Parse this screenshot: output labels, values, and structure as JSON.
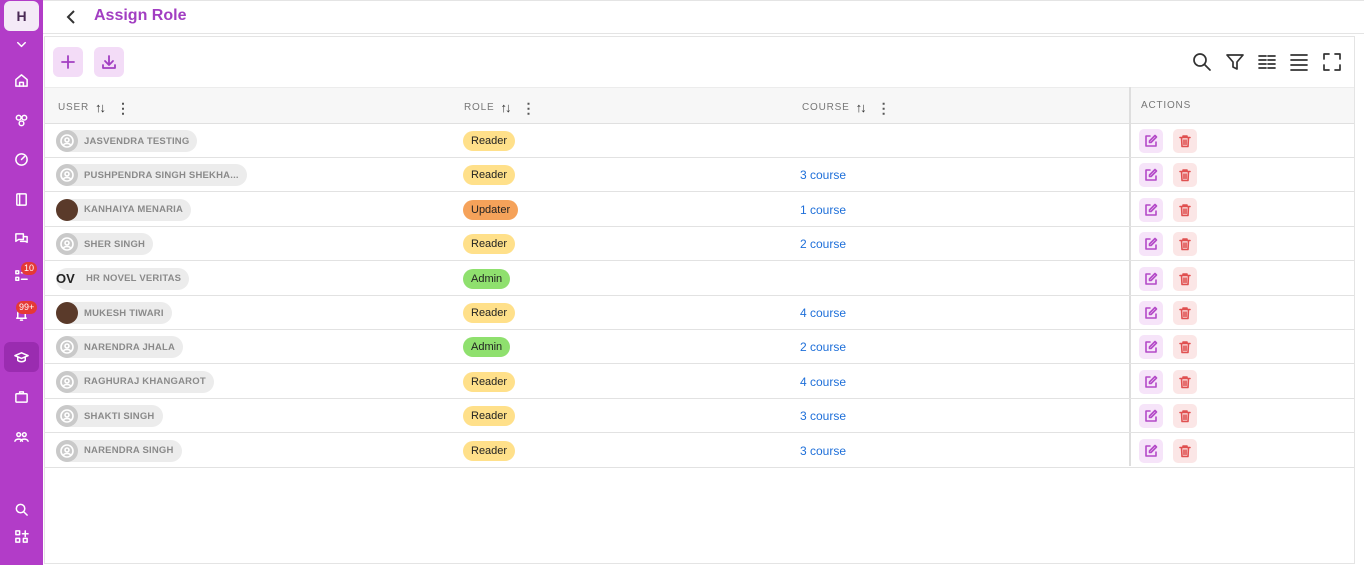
{
  "app": {
    "logo_letter": "H"
  },
  "sidebar": {
    "icons": [
      "chevron-down-icon",
      "home-icon",
      "network-icon",
      "gauge-icon",
      "book-icon",
      "chat-icon",
      "tasks-icon",
      "bell-icon",
      "graduation-cap-icon",
      "briefcase-icon",
      "people-icon",
      "search-icon",
      "apps-icon"
    ],
    "tasks_badge": "10",
    "notifications_badge": "99+"
  },
  "header": {
    "title": "Assign Role"
  },
  "table": {
    "columns": {
      "user": "USER",
      "role": "ROLE",
      "course": "COURSE",
      "actions": "ACTIONS"
    },
    "rows": [
      {
        "user": "JASVENDRA TESTING",
        "role": "Reader",
        "role_type": "reader",
        "course": "",
        "avatar": "default"
      },
      {
        "user": "PUSHPENDRA SINGH SHEKHA...",
        "role": "Reader",
        "role_type": "reader",
        "course": "3 course",
        "avatar": "default"
      },
      {
        "user": "KANHAIYA MENARIA",
        "role": "Updater",
        "role_type": "updater",
        "course": "1 course",
        "avatar": "photo"
      },
      {
        "user": "SHER SINGH",
        "role": "Reader",
        "role_type": "reader",
        "course": "2 course",
        "avatar": "default"
      },
      {
        "user": "HR NOVEL VERITAS",
        "role": "Admin",
        "role_type": "admin",
        "course": "",
        "avatar": "ov",
        "avatar_text": "OV"
      },
      {
        "user": "MUKESH TIWARI",
        "role": "Reader",
        "role_type": "reader",
        "course": "4 course",
        "avatar": "photo"
      },
      {
        "user": "NARENDRA JHALA",
        "role": "Admin",
        "role_type": "admin",
        "course": "2 course",
        "avatar": "default"
      },
      {
        "user": "RAGHURAJ KHANGAROT",
        "role": "Reader",
        "role_type": "reader",
        "course": "4 course",
        "avatar": "default"
      },
      {
        "user": "SHAKTI SINGH",
        "role": "Reader",
        "role_type": "reader",
        "course": "3 course",
        "avatar": "default"
      },
      {
        "user": "NARENDRA SINGH",
        "role": "Reader",
        "role_type": "reader",
        "course": "3 course",
        "avatar": "default"
      }
    ]
  },
  "colors": {
    "brand": "#b23cc8",
    "title": "#a23ec2",
    "link": "#1e6fd9",
    "reader": "#ffe08a",
    "updater": "#f5a25a",
    "admin": "#8fe06e"
  }
}
